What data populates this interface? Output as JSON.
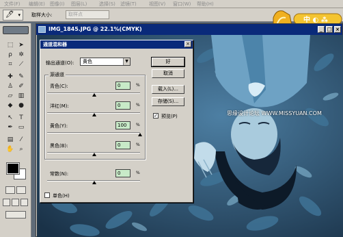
{
  "menubar": {
    "items": [
      "文件(F)",
      "编辑(E)",
      "图像(I)",
      "图层(L)",
      "选择(S)",
      "滤镜(T)",
      "视图(V)",
      "窗口(W)",
      "帮助(H)"
    ]
  },
  "options_bar": {
    "tool_icon": "eyedropper-icon",
    "sample_size_label": "取样大小:",
    "sample_size_value": "取样点"
  },
  "logo": {
    "text": "中 ◐ ⁂"
  },
  "document": {
    "title": "IMG_1845.JPG @ 22.1%(CMYK)",
    "zoom": "22.1%",
    "mode": "CMYK"
  },
  "dialog": {
    "title": "通道混和器",
    "output_channel_label": "输出通道(O):",
    "output_channel_value": "黄色",
    "source_group_label": "源通道",
    "channels": [
      {
        "label": "青色(C):",
        "value": "0",
        "unit": "%"
      },
      {
        "label": "洋红(M):",
        "value": "0",
        "unit": "%"
      },
      {
        "label": "黄色(Y):",
        "value": "100",
        "unit": "%"
      },
      {
        "label": "黑色(B):",
        "value": "0",
        "unit": "%"
      }
    ],
    "constant": {
      "label": "常数(N):",
      "value": "0",
      "unit": "%"
    },
    "monochrome_label": "单色(H)",
    "monochrome_checked": false,
    "buttons": {
      "ok": "好",
      "cancel": "取消",
      "load": "载入(L)...",
      "save": "存储(S)..."
    },
    "preview_label": "预览(P)",
    "preview_checked": true
  },
  "watermark": "思缘设计论坛 WWW.MISSYUAN.COM",
  "colors": {
    "titlebar": "#0a2a7a",
    "panel": "#d4d0c8",
    "field_green": "#c8eac8",
    "photo_dark": "#1f3a52",
    "photo_light": "#6fa7c9"
  }
}
